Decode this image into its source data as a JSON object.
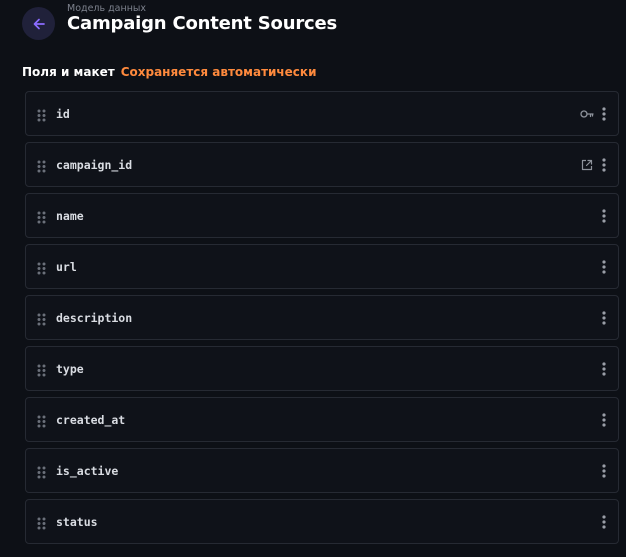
{
  "header": {
    "breadcrumb": "Модель данных",
    "title": "Campaign Content Sources"
  },
  "section": {
    "title": "Поля и макет",
    "autosave_status": "Сохраняется автоматически"
  },
  "fields": [
    {
      "name": "id",
      "badge": "key-icon"
    },
    {
      "name": "campaign_id",
      "badge": "external-link-icon"
    },
    {
      "name": "name",
      "badge": null
    },
    {
      "name": "url",
      "badge": null
    },
    {
      "name": "description",
      "badge": null
    },
    {
      "name": "type",
      "badge": null
    },
    {
      "name": "created_at",
      "badge": null
    },
    {
      "name": "is_active",
      "badge": null
    },
    {
      "name": "status",
      "badge": null
    }
  ],
  "colors": {
    "background": "#0d1016",
    "accent": "#7c5cff",
    "autosave": "#ff8a3d"
  }
}
